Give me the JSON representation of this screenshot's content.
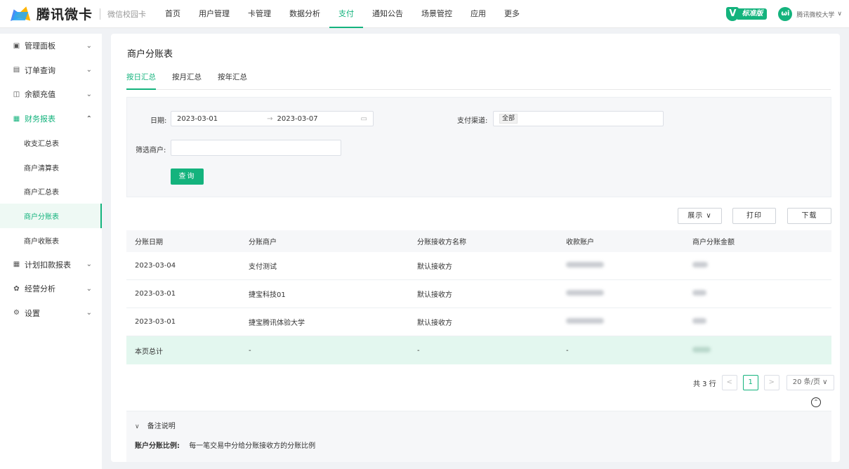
{
  "brand": {
    "name": "腾讯微卡",
    "sub": "微信校园卡"
  },
  "topnav": [
    {
      "label": "首页"
    },
    {
      "label": "用户管理"
    },
    {
      "label": "卡管理"
    },
    {
      "label": "数据分析"
    },
    {
      "label": "支付",
      "active": true
    },
    {
      "label": "通知公告"
    },
    {
      "label": "场景管控"
    },
    {
      "label": "应用"
    },
    {
      "label": "更多"
    }
  ],
  "badge": {
    "letter": "V",
    "label": "标准版"
  },
  "org": {
    "logo": "ωi",
    "name": "腾讯微校大学",
    "caret": "∨"
  },
  "sidebar": {
    "items": [
      {
        "label": "管理面板",
        "icon": "dashboard-icon"
      },
      {
        "label": "订单查询",
        "icon": "order-icon"
      },
      {
        "label": "余额充值",
        "icon": "wallet-icon"
      },
      {
        "label": "财务报表",
        "icon": "report-icon"
      },
      {
        "label": "计划扣款报表",
        "icon": "grid-icon"
      },
      {
        "label": "经营分析",
        "icon": "analysis-icon"
      },
      {
        "label": "设置",
        "icon": "settings-icon"
      }
    ],
    "sub": [
      {
        "label": "收支汇总表"
      },
      {
        "label": "商户清算表"
      },
      {
        "label": "商户汇总表"
      },
      {
        "label": "商户分账表",
        "active": true
      },
      {
        "label": "商户收账表"
      }
    ]
  },
  "page": {
    "title": "商户分账表",
    "tabs": [
      {
        "label": "按日汇总",
        "active": true
      },
      {
        "label": "按月汇总"
      },
      {
        "label": "按年汇总"
      }
    ]
  },
  "filter": {
    "date_label": "日期:",
    "date_start": "2023-03-01",
    "date_arrow": "→",
    "date_end": "2023-03-07",
    "channel_label": "支付渠道:",
    "channel_value": "全部",
    "merchant_label": "筛选商户:",
    "merchant_value": "",
    "query_button": "查询"
  },
  "toolbar": {
    "display_label": "展示 ∨",
    "print_label": "打印",
    "download_label": "下载"
  },
  "table": {
    "headers": [
      "分账日期",
      "分账商户",
      "分账接收方名称",
      "收款账户",
      "商户分账金额"
    ],
    "rows": [
      [
        "2023-03-04",
        "支付测试",
        "默认接收方"
      ],
      [
        "2023-03-01",
        "捷宝科技01",
        "默认接收方"
      ],
      [
        "2023-03-01",
        "捷宝腾讯体验大学",
        "默认接收方"
      ]
    ],
    "footer": [
      "本页总计",
      "-",
      "-",
      "-"
    ]
  },
  "pagination": {
    "total": "共 3 行",
    "prev": "<",
    "current": "1",
    "next": ">",
    "page_size": "20 条/页 ∨"
  },
  "notes": {
    "title": "备注说明",
    "term": "账户分账比例:",
    "desc": "每一笔交易中分给分账接收方的分账比例"
  },
  "colors": {
    "accent": "#14b37d"
  }
}
